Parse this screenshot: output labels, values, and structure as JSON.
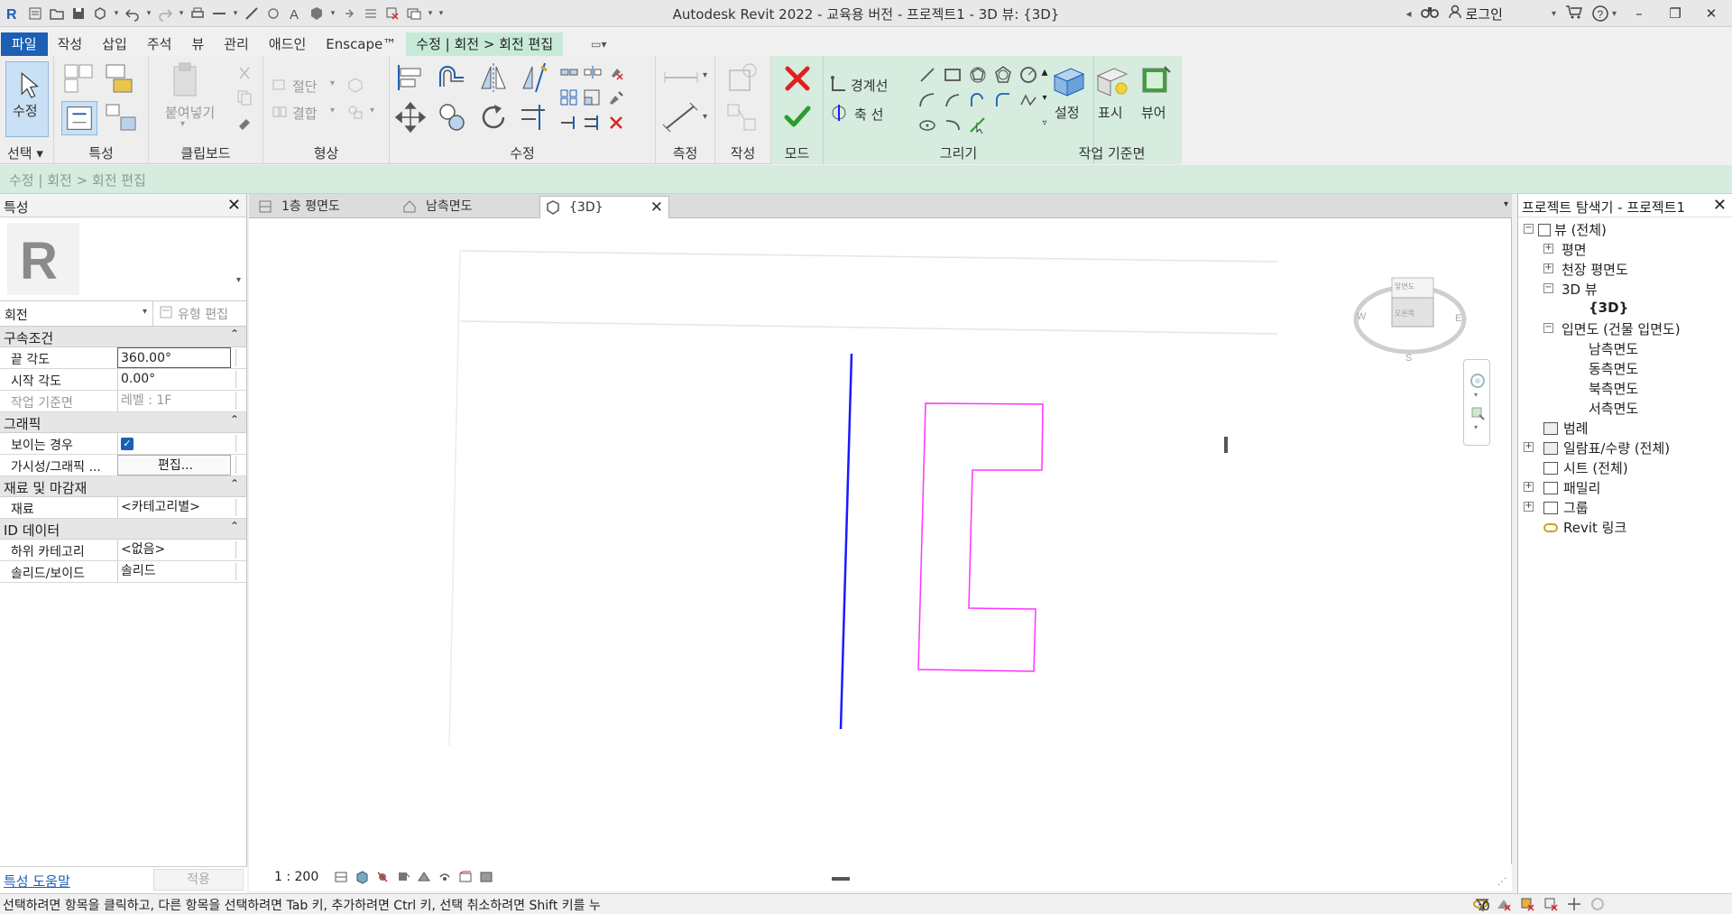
{
  "app": {
    "title": "Autodesk Revit 2022 - 교육용 버전 - 프로젝트1 - 3D 뷰: {3D}",
    "login_label": "로그인"
  },
  "menu": {
    "file": "파일",
    "tabs": [
      "작성",
      "삽입",
      "주석",
      "뷰",
      "관리",
      "애드인",
      "Enscape™"
    ],
    "context_tab": "수정 | 회전 > 회전 편집"
  },
  "ribbon": {
    "select_label": "선택",
    "modify_label": "수정",
    "properties_label": "특성",
    "clipboard_label": "클립보드",
    "paste_label": "붙여넣기",
    "geometry_label": "형상",
    "cut_label": "절단",
    "join_label": "결합",
    "modify_panel_label": "수정",
    "measure_label": "측정",
    "create_label": "작성",
    "mode_label": "모드",
    "draw_label": "그리기",
    "boundary_line_label": "경계선",
    "axis_line_label": "축 선",
    "workplane_label": "작업 기준면",
    "set_label": "설정",
    "show_label": "표시",
    "viewer_label": "뷰어"
  },
  "optionsbar": {
    "text": "수정 | 회전 > 회전 편집"
  },
  "properties": {
    "title": "특성",
    "type_name": "회전",
    "edit_type_label": "유형 편집",
    "groups": [
      {
        "name": "구속조건",
        "rows": [
          {
            "key": "끝 각도",
            "value": "360.00°"
          },
          {
            "key": "시작 각도",
            "value": "0.00°"
          },
          {
            "key": "작업 기준면",
            "value": "레벨 : 1F"
          }
        ]
      },
      {
        "name": "그래픽",
        "rows": [
          {
            "key": "보이는 경우",
            "value": ""
          },
          {
            "key": "가시성/그래픽 ...",
            "value": "편집..."
          }
        ]
      },
      {
        "name": "재료 및 마감재",
        "rows": [
          {
            "key": "재료",
            "value": "<카테고리별>"
          }
        ]
      },
      {
        "name": "ID 데이터",
        "rows": [
          {
            "key": "하위 카테고리",
            "value": "<없음>"
          },
          {
            "key": "솔리드/보이드",
            "value": "솔리드"
          }
        ]
      }
    ],
    "visible_checked": true,
    "help_link": "특성 도움말",
    "apply_label": "적용"
  },
  "view_tabs": [
    {
      "label": "1층 평면도"
    },
    {
      "label": "남측면도"
    },
    {
      "label": "{3D}"
    }
  ],
  "viewbar": {
    "scale": "1 : 200"
  },
  "viewcube": {
    "top_label": "앞면도",
    "front_label": "오른쪽"
  },
  "browser": {
    "title": "프로젝트 탐색기 - 프로젝트1",
    "nodes": {
      "views": "뷰 (전체)",
      "floor_plans": "평면",
      "ceiling_plans": "천장 평면도",
      "views_3d": "3D 뷰",
      "view_3d_item": "{3D}",
      "elevations": "입면도 (건물 입면도)",
      "elev_south": "남측면도",
      "elev_east": "동측면도",
      "elev_north": "북측면도",
      "elev_west": "서측면도",
      "legends": "범례",
      "schedules": "일람표/수량 (전체)",
      "sheets": "시트 (전체)",
      "families": "패밀리",
      "groups": "그룹",
      "revit_links": "Revit 링크"
    }
  },
  "status": {
    "text": "선택하려면 항목을 클릭하고, 다른 항목을 선택하려면 Tab 키, 추가하려면 Ctrl 키, 선택 취소하려면 Shift 키를 누",
    "filter_count": ":0"
  },
  "colors": {
    "file_tab": "#1c5fb3",
    "context": "#d5ecdf",
    "axis_line": "#1a1aff",
    "boundary_line": "#ff33ff"
  }
}
